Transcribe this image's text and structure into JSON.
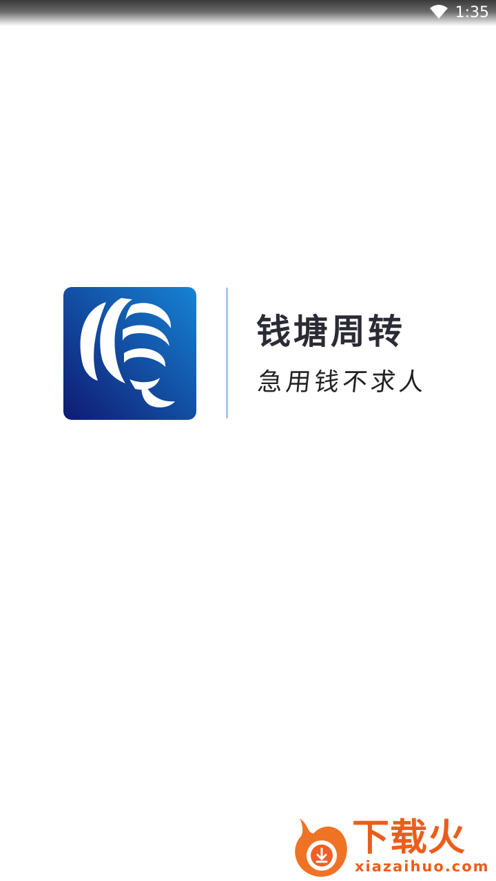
{
  "status_bar": {
    "time": "1:35",
    "wifi_icon": "wifi-icon"
  },
  "splash": {
    "brand_name": "钱塘周转",
    "slogan": "急用钱不求人",
    "logo_icon": "q-globe-logo-icon",
    "colors": {
      "logo_gradient_start": "#1683d4",
      "logo_gradient_end": "#0f1a72",
      "divider": "#a9c7ee",
      "brand_text": "#2b2b35"
    }
  },
  "watermark": {
    "name": "下载火",
    "url": "xiazaihuo.com",
    "icon": "fire-download-icon",
    "color": "#ec5d1c"
  }
}
